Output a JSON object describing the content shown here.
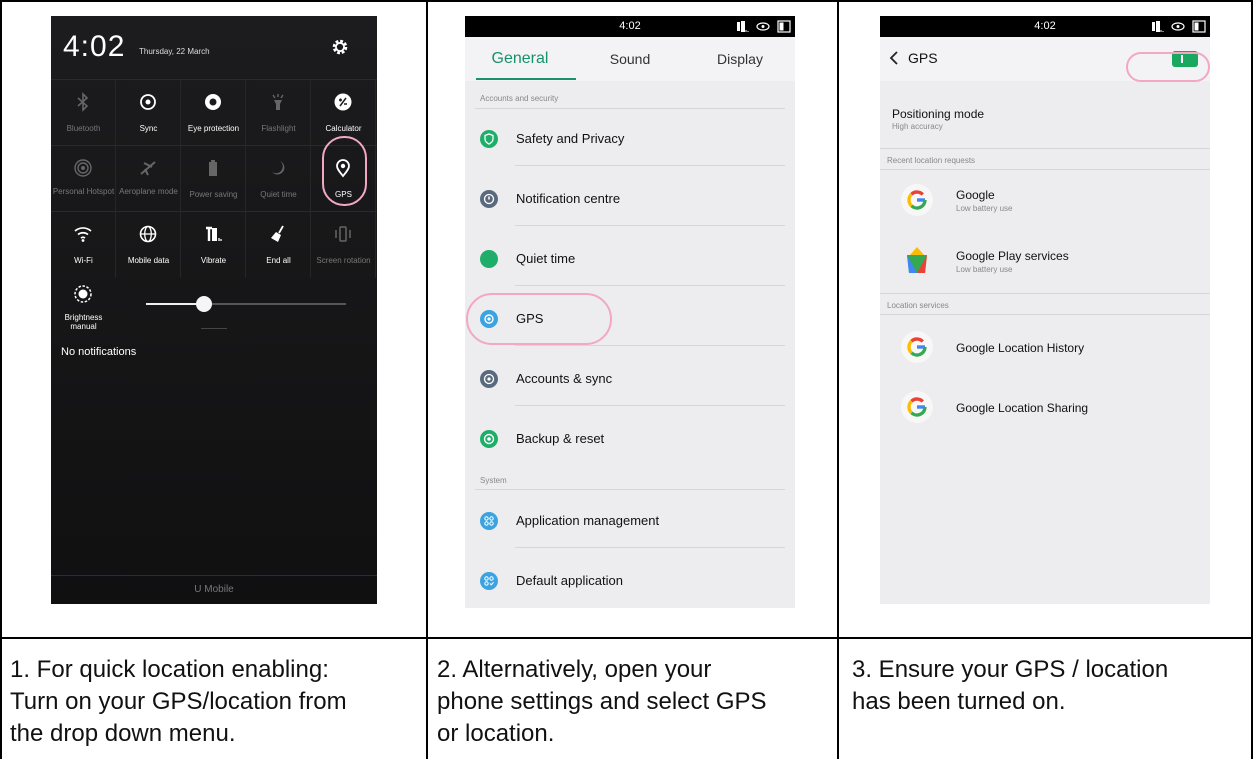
{
  "panel1": {
    "time": "4:02",
    "date": "Thursday, 22 March",
    "tiles": [
      {
        "label": "Bluetooth",
        "icon": "bluetooth-icon",
        "enabled": false
      },
      {
        "label": "Sync",
        "icon": "sync-icon",
        "enabled": true
      },
      {
        "label": "Eye protection",
        "icon": "eye-protection-icon",
        "enabled": true
      },
      {
        "label": "Flashlight",
        "icon": "flashlight-icon",
        "enabled": false
      },
      {
        "label": "Calculator",
        "icon": "calculator-icon",
        "enabled": true
      },
      {
        "label": "Personal Hotspot",
        "icon": "hotspot-icon",
        "enabled": false
      },
      {
        "label": "Aeroplane mode",
        "icon": "airplane-icon",
        "enabled": false
      },
      {
        "label": "Power saving",
        "icon": "battery-icon",
        "enabled": false
      },
      {
        "label": "Quiet time",
        "icon": "moon-icon",
        "enabled": false
      },
      {
        "label": "GPS",
        "icon": "location-pin-icon",
        "enabled": true
      },
      {
        "label": "Wi-Fi",
        "icon": "wifi-icon",
        "enabled": true
      },
      {
        "label": "Mobile data",
        "icon": "globe-icon",
        "enabled": true
      },
      {
        "label": "Vibrate",
        "icon": "vibrate-icon",
        "enabled": true
      },
      {
        "label": "End all",
        "icon": "broom-icon",
        "enabled": true
      },
      {
        "label": "Screen rotation",
        "icon": "rotation-icon",
        "enabled": false
      }
    ],
    "brightness_label": "Brightness manual",
    "brightness_level": 0.29,
    "no_notifications": "No notifications",
    "carrier": "U Mobile"
  },
  "panel2": {
    "time": "4:02",
    "tabs": [
      "General",
      "Sound",
      "Display"
    ],
    "active_tab": 0,
    "section_accounts": "Accounts and security",
    "section_system": "System",
    "items": [
      {
        "label": "Safety and Privacy",
        "icon": "shield-icon",
        "color": "#1fae6a"
      },
      {
        "label": "Notification centre",
        "icon": "notification-icon",
        "color": "#5a6a7e"
      },
      {
        "label": "Quiet time",
        "icon": "moon-icon",
        "color": "#1fae6a"
      },
      {
        "label": "GPS",
        "icon": "location-icon",
        "color": "#3aa3e0"
      },
      {
        "label": "Accounts & sync",
        "icon": "sync-icon",
        "color": "#5a6a7e"
      },
      {
        "label": "Backup & reset",
        "icon": "backup-icon",
        "color": "#1fae6a"
      },
      {
        "label": "Application management",
        "icon": "apps-icon",
        "color": "#3aa3e0"
      },
      {
        "label": "Default application",
        "icon": "default-apps-icon",
        "color": "#3aa3e0"
      }
    ]
  },
  "panel3": {
    "time": "4:02",
    "title": "GPS",
    "toggle_on": true,
    "positioning_title": "Positioning mode",
    "positioning_value": "High accuracy",
    "section_recent": "Recent location requests",
    "section_services": "Location services",
    "recent": [
      {
        "name": "Google",
        "sub": "Low battery use"
      },
      {
        "name": "Google Play services",
        "sub": "Low battery use"
      }
    ],
    "services": [
      {
        "name": "Google Location History"
      },
      {
        "name": "Google Location Sharing"
      }
    ]
  },
  "captions": {
    "c1": [
      "1. For quick location enabling:",
      "Turn on your GPS/location from",
      "the drop down menu."
    ],
    "c2": [
      "2. Alternatively, open your",
      "phone settings and select GPS",
      "or location."
    ],
    "c3": [
      "3. Ensure your GPS / location",
      "has been turned on."
    ]
  }
}
